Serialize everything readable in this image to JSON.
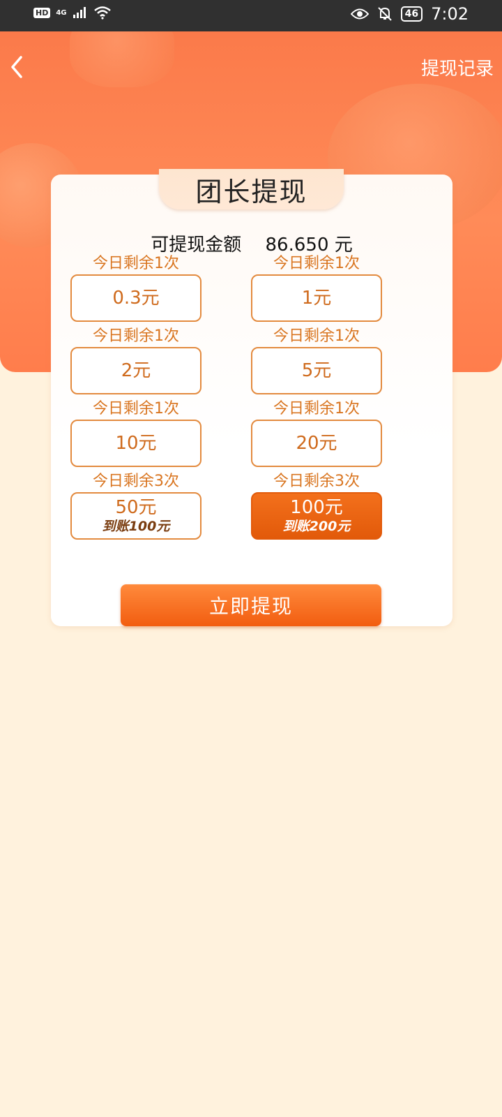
{
  "status_bar": {
    "left_badge": "HD",
    "network": "4G",
    "battery": "46",
    "time": "7:02",
    "icons": [
      "signal-icon",
      "wifi-icon",
      "eye-icon",
      "mute-bell-icon",
      "battery-icon"
    ]
  },
  "header": {
    "back_icon": "chevron-left-icon",
    "history_label": "提现记录"
  },
  "card": {
    "title": "团长提现",
    "balance_label": "可提现金额",
    "balance_value": "86.650 元"
  },
  "options": [
    {
      "remain": "今日剩余1次",
      "amount": "0.3元",
      "bonus": ""
    },
    {
      "remain": "今日剩余1次",
      "amount": "1元",
      "bonus": ""
    },
    {
      "remain": "今日剩余1次",
      "amount": "2元",
      "bonus": ""
    },
    {
      "remain": "今日剩余1次",
      "amount": "5元",
      "bonus": ""
    },
    {
      "remain": "今日剩余1次",
      "amount": "10元",
      "bonus": ""
    },
    {
      "remain": "今日剩余1次",
      "amount": "20元",
      "bonus": ""
    },
    {
      "remain": "今日剩余3次",
      "amount": "50元",
      "bonus": "到账100元"
    },
    {
      "remain": "今日剩余3次",
      "amount": "100元",
      "bonus": "到账200元"
    }
  ],
  "selected_option": "100元",
  "submit_label": "立即提现",
  "colors": {
    "header": "#ff8453",
    "accent": "#f25d10",
    "option_border": "#e38a3e",
    "page_bg": "#fff2dd"
  }
}
